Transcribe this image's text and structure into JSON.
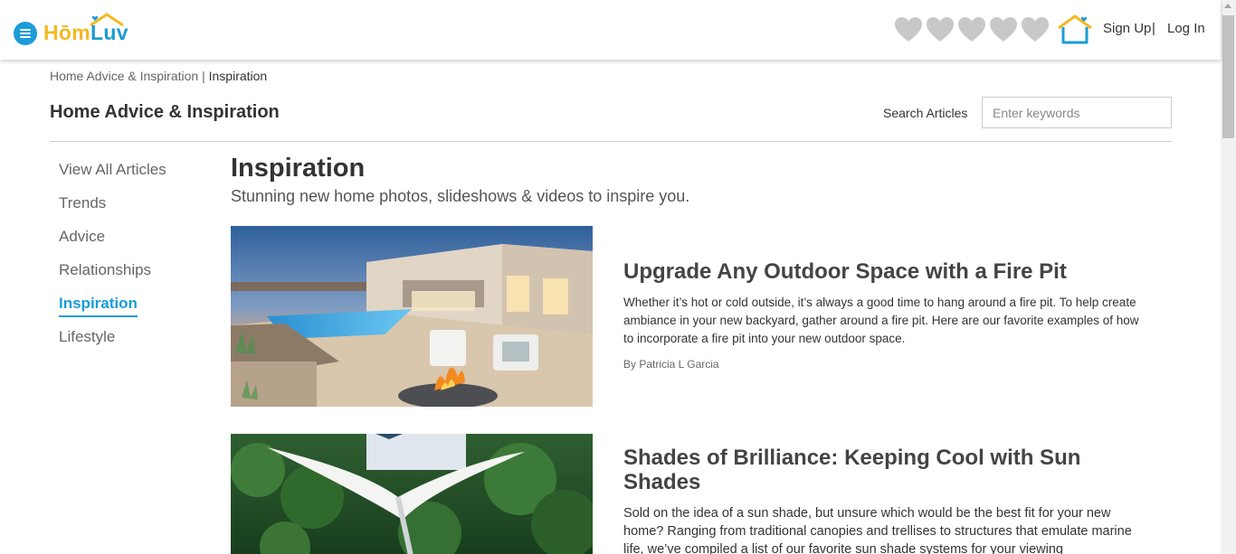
{
  "header": {
    "brand_part1": "Hōm",
    "brand_part2": "Luv",
    "signup_label": "Sign Up",
    "separator": "|",
    "login_label": "Log In",
    "hearts_count": 5,
    "colors": {
      "accent": "#1b9bd8",
      "brand_yellow": "#f5b823",
      "heart_gray": "#c8c8c8"
    }
  },
  "breadcrumb": {
    "parent": "Home Advice & Inspiration",
    "separator": "|",
    "current": "Inspiration"
  },
  "page": {
    "title": "Home Advice & Inspiration",
    "search_label": "Search Articles",
    "search_placeholder": "Enter keywords",
    "search_value": ""
  },
  "sidebar": {
    "items": [
      {
        "label": "View All Articles",
        "active": false
      },
      {
        "label": "Trends",
        "active": false
      },
      {
        "label": "Advice",
        "active": false
      },
      {
        "label": "Relationships",
        "active": false
      },
      {
        "label": "Inspiration",
        "active": true
      },
      {
        "label": "Lifestyle",
        "active": false
      }
    ]
  },
  "section": {
    "title": "Inspiration",
    "subtitle": "Stunning new home photos, slideshows & videos to inspire you."
  },
  "articles": [
    {
      "title": "Upgrade Any Outdoor Space with a Fire Pit",
      "excerpt": "Whether it’s hot or cold outside, it’s always a good time to hang around a fire pit. To help create ambiance in your new backyard, gather around a fire pit. Here are our favorite examples of how to incorporate a fire pit into your new outdoor space.",
      "author": "By Patricia L Garcia",
      "image": "outdoor-fire-pit-photo"
    },
    {
      "title": "Shades of Brilliance: Keeping Cool with Sun Shades",
      "excerpt": "Sold on the idea of a sun shade, but unsure which would be the best fit for your new home? Ranging from traditional canopies and trellises to structures that emulate marine life, we’ve compiled a list of our favorite sun shade systems for your viewing",
      "author": "",
      "image": "sun-shade-photo"
    }
  ]
}
